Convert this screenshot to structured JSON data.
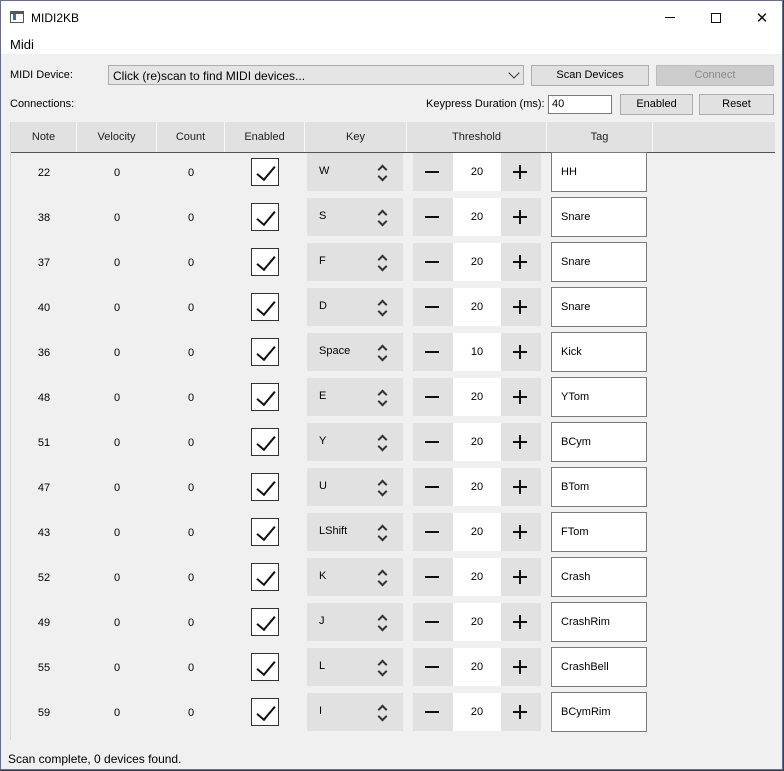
{
  "window": {
    "title": "MIDI2KB",
    "minimize_glyph": "minimize-icon",
    "maximize_glyph": "maximize-icon",
    "close_glyph": "✕"
  },
  "menu": {
    "items": [
      "Midi"
    ]
  },
  "device": {
    "label": "MIDI Device:",
    "selected": "Click (re)scan to find MIDI devices...",
    "scan_label": "Scan Devices",
    "connect_label": "Connect"
  },
  "connections": {
    "label": "Connections:",
    "duration_label": "Keypress Duration (ms):",
    "duration_value": "40",
    "enabled_label": "Enabled",
    "reset_label": "Reset"
  },
  "table": {
    "headers": [
      "Note",
      "Velocity",
      "Count",
      "Enabled",
      "Key",
      "Threshold",
      "Tag"
    ],
    "rows": [
      {
        "note": "22",
        "velocity": "0",
        "count": "0",
        "enabled": true,
        "key": "W",
        "threshold": "20",
        "tag": "HH"
      },
      {
        "note": "38",
        "velocity": "0",
        "count": "0",
        "enabled": true,
        "key": "S",
        "threshold": "20",
        "tag": "Snare"
      },
      {
        "note": "37",
        "velocity": "0",
        "count": "0",
        "enabled": true,
        "key": "F",
        "threshold": "20",
        "tag": "Snare"
      },
      {
        "note": "40",
        "velocity": "0",
        "count": "0",
        "enabled": true,
        "key": "D",
        "threshold": "20",
        "tag": "Snare"
      },
      {
        "note": "36",
        "velocity": "0",
        "count": "0",
        "enabled": true,
        "key": "Space",
        "threshold": "10",
        "tag": "Kick"
      },
      {
        "note": "48",
        "velocity": "0",
        "count": "0",
        "enabled": true,
        "key": "E",
        "threshold": "20",
        "tag": "YTom"
      },
      {
        "note": "51",
        "velocity": "0",
        "count": "0",
        "enabled": true,
        "key": "Y",
        "threshold": "20",
        "tag": "BCym"
      },
      {
        "note": "47",
        "velocity": "0",
        "count": "0",
        "enabled": true,
        "key": "U",
        "threshold": "20",
        "tag": "BTom"
      },
      {
        "note": "43",
        "velocity": "0",
        "count": "0",
        "enabled": true,
        "key": "LShift",
        "threshold": "20",
        "tag": "FTom"
      },
      {
        "note": "52",
        "velocity": "0",
        "count": "0",
        "enabled": true,
        "key": "K",
        "threshold": "20",
        "tag": "Crash"
      },
      {
        "note": "49",
        "velocity": "0",
        "count": "0",
        "enabled": true,
        "key": "J",
        "threshold": "20",
        "tag": "CrashRim"
      },
      {
        "note": "55",
        "velocity": "0",
        "count": "0",
        "enabled": true,
        "key": "L",
        "threshold": "20",
        "tag": "CrashBell"
      },
      {
        "note": "59",
        "velocity": "0",
        "count": "0",
        "enabled": true,
        "key": "I",
        "threshold": "20",
        "tag": "BCymRim"
      }
    ]
  },
  "status": {
    "text": "Scan complete, 0 devices found."
  }
}
